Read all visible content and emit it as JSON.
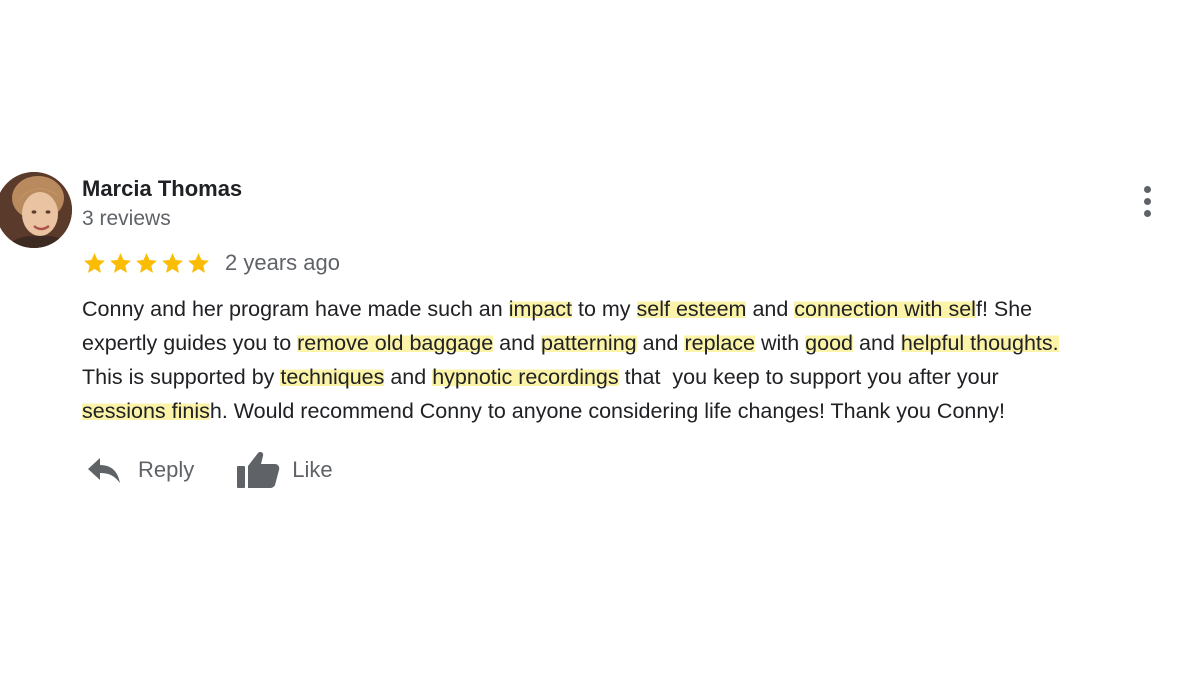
{
  "review": {
    "author_name": "Marcia Thomas",
    "author_reviews": "3 reviews",
    "rating": 5,
    "rating_max": 5,
    "star_color": "#fbbc04",
    "date": "2 years ago",
    "highlight_color": "#fbf3a8",
    "text_lines": [
      [
        {
          "t": "Conny and her program have made such an "
        },
        {
          "t": "impact",
          "hl": true
        },
        {
          "t": " to my "
        },
        {
          "t": "self esteem",
          "hl": true
        },
        {
          "t": " and "
        },
        {
          "t": "connection with sel",
          "hl": true
        },
        {
          "t": "f! She"
        }
      ],
      [
        {
          "t": "expertly guides you to "
        },
        {
          "t": "remove old baggage",
          "hl": true
        },
        {
          "t": " and "
        },
        {
          "t": "patterning",
          "hl": true
        },
        {
          "t": " and "
        },
        {
          "t": "replace",
          "hl": true
        },
        {
          "t": " with "
        },
        {
          "t": "good",
          "hl": true
        },
        {
          "t": " and "
        },
        {
          "t": "helpful thoughts.",
          "hl": true
        }
      ],
      [
        {
          "t": "This is supported by "
        },
        {
          "t": "techniques",
          "hl": true
        },
        {
          "t": " and "
        },
        {
          "t": "hypnotic recordings",
          "hl": true
        },
        {
          "t": " that  you keep to support you after your"
        }
      ],
      [
        {
          "t": "sessions finis",
          "hl": true
        },
        {
          "t": "h. Would recommend Conny to anyone considering life changes! Thank you Conny!"
        }
      ]
    ]
  },
  "actions": {
    "reply_label": "Reply",
    "like_label": "Like",
    "reply_icon": "reply-arrow-icon",
    "like_icon": "thumbs-up-icon",
    "more_icon": "more-vert-icon",
    "color": "#5f6368"
  }
}
